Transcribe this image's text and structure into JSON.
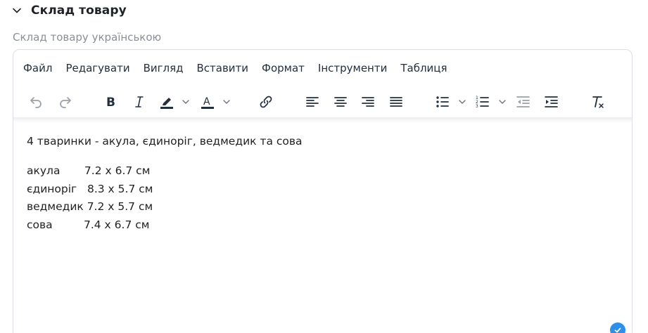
{
  "section": {
    "title": "Склад товару",
    "toggle_icon": "chevron-down-icon"
  },
  "field": {
    "label": "Склад товару українською"
  },
  "editor": {
    "menubar": [
      {
        "id": "file",
        "label": "Файл"
      },
      {
        "id": "edit",
        "label": "Редагувати"
      },
      {
        "id": "view",
        "label": "Вигляд"
      },
      {
        "id": "insert",
        "label": "Вставити"
      },
      {
        "id": "format",
        "label": "Формат"
      },
      {
        "id": "tools",
        "label": "Інструменти"
      },
      {
        "id": "table",
        "label": "Таблиця"
      }
    ],
    "toolbar_icons": [
      "undo-icon",
      "redo-icon",
      "bold-icon",
      "italic-icon",
      "highlight-color-icon",
      "text-color-icon",
      "link-icon",
      "align-left-icon",
      "align-center-icon",
      "align-right-icon",
      "align-justify-icon",
      "bullet-list-icon",
      "numbered-list-icon",
      "outdent-icon",
      "indent-icon",
      "clear-formatting-icon"
    ],
    "content": {
      "intro": "4 тваринки - акула,  єдиноріг, ведмедик та сова",
      "items": [
        "акула       7.2 х 6.7 см",
        "єдиноріг   8.3 х 5.7 см",
        "ведмедик 7.2 х 5.7 см",
        "сова         7.4 х 6.7 см"
      ]
    },
    "status_icon": "check-circle-icon"
  },
  "colors": {
    "accent": "#2f8ee8",
    "toolbar_icon": "#222f3e",
    "label_muted": "#8a8f98",
    "border": "#dcdfe4"
  }
}
